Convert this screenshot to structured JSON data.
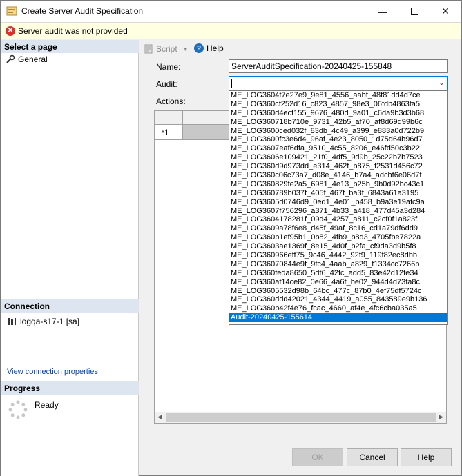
{
  "window": {
    "title": "Create Server Audit Specification"
  },
  "error": {
    "message": "Server audit was not provided"
  },
  "left": {
    "select_page_header": "Select a page",
    "pages": [
      {
        "label": "General"
      }
    ],
    "connection_header": "Connection",
    "connection_label": "logqa-s17-1 [sa]",
    "view_connection_link": "View connection properties",
    "progress_header": "Progress",
    "progress_status": "Ready"
  },
  "toolbar": {
    "script_label": "Script",
    "help_label": "Help"
  },
  "form": {
    "name_label": "Name:",
    "name_value": "ServerAuditSpecification-20240425-155848",
    "audit_label": "Audit:",
    "audit_value": "",
    "actions_label": "Actions:"
  },
  "grid": {
    "row1_label": "1",
    "row1_marker": "*"
  },
  "audit_options": [
    "ME_LOG3604f7e27e9_9e81_4556_aabf_48f81dd4d7ce",
    "ME_LOG360cf252d16_c823_4857_98e3_06fdb4863fa5",
    "ME_LOG360d4ecf155_9676_480d_9a01_c6da9b3d3b68",
    "ME_LOG360718b710e_9731_42b5_af70_af8d69d99b6c",
    "ME_LOG3600ced032f_83db_4c49_a399_e883a0d722b9",
    "ME_LOG3600fc3e6d4_96af_4e23_8050_1d75d64b96d7",
    "ME_LOG3607eaf6dfa_9510_4c55_8206_e46fd50c3b22",
    "ME_LOG3606e109421_21f0_4df5_9d9b_25c22b7b7523",
    "ME_LOG360d9d973dd_e314_462f_b875_f2531d456c72",
    "ME_LOG360c06c73a7_d08e_4146_b7a4_adcbf6e06d7f",
    "ME_LOG360829fe2a5_6981_4e13_b25b_9b0d92bc43c1",
    "ME_LOG360789b037f_405f_467f_ba3f_6843a61a3195",
    "ME_LOG3605d0746d9_0ed1_4e01_b458_b9a3e19afc9a",
    "ME_LOG3607f756296_a371_4b33_a418_477d45a3d284",
    "ME_LOG3604178281f_09d4_4257_a811_c2cf0f1a823f",
    "ME_LOG3609a78f6e8_d45f_49af_8c16_cd1a79df6dd9",
    "ME_LOG360b1ef95b1_0b82_4fb9_b8d3_4705fbe7822a",
    "ME_LOG3603ae1369f_8e15_4d0f_b2fa_cf9da3d9b5f8",
    "ME_LOG360966eff75_9c46_4442_92f9_119f82ec8dbb",
    "ME_LOG36070844e9f_9fc4_4aab_a829_f1334cc7266b",
    "ME_LOG360feda8650_5df6_42fc_add5_83e42d12fe34",
    "ME_LOG360af14ce82_0e66_4a6f_be02_944d4d73fa8c",
    "ME_LOG3605532d98b_64bc_477c_87b0_4ef75df5724c",
    "ME_LOG360ddd42021_4344_4419_a055_843589e9b136",
    "ME_LOG360b42f4e76_fcac_4660_af4e_4fc6cba035a5",
    "Audit-20240425-155614"
  ],
  "selected_audit_index": 25,
  "buttons": {
    "ok": "OK",
    "cancel": "Cancel",
    "help": "Help"
  }
}
